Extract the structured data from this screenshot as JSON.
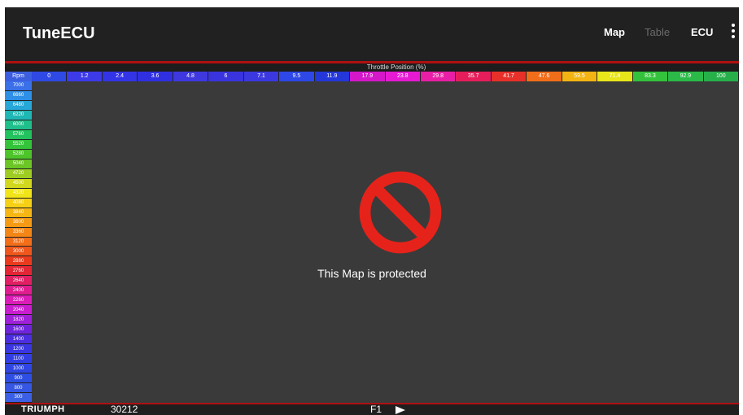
{
  "app": {
    "title": "TuneECU"
  },
  "nav": {
    "map_label": "Map",
    "table_label": "Table",
    "ecu_label": "ECU",
    "menu_icon": "more-vert-icon"
  },
  "grid": {
    "x_axis_title": "Throttle Position (%)",
    "rpm_header": "Rpm",
    "tps_columns": [
      {
        "label": "0",
        "color": "#2f49e4"
      },
      {
        "label": "1.2",
        "color": "#3d3ae8"
      },
      {
        "label": "2.4",
        "color": "#3234e6"
      },
      {
        "label": "3.6",
        "color": "#3030e2"
      },
      {
        "label": "4.8",
        "color": "#3f38df"
      },
      {
        "label": "6",
        "color": "#3a34df"
      },
      {
        "label": "7.1",
        "color": "#3b38e0"
      },
      {
        "label": "9.5",
        "color": "#2d48e6"
      },
      {
        "label": "11.9",
        "color": "#2437d8"
      },
      {
        "label": "17.9",
        "color": "#d417c9"
      },
      {
        "label": "23.8",
        "color": "#e51ad2"
      },
      {
        "label": "29.8",
        "color": "#e81fa6"
      },
      {
        "label": "35.7",
        "color": "#e51d5b"
      },
      {
        "label": "41.7",
        "color": "#e8302a"
      },
      {
        "label": "47.6",
        "color": "#f06d1a"
      },
      {
        "label": "59.5",
        "color": "#f3b413"
      },
      {
        "label": "71.4",
        "color": "#e8e61b"
      },
      {
        "label": "83.3",
        "color": "#34c23c"
      },
      {
        "label": "92.9",
        "color": "#2bba48"
      },
      {
        "label": "100",
        "color": "#27b04a"
      }
    ],
    "rpm_rows": [
      {
        "label": "7000",
        "color": "#3a70e8"
      },
      {
        "label": "6660",
        "color": "#2e8fe6"
      },
      {
        "label": "6480",
        "color": "#26a7d8"
      },
      {
        "label": "6220",
        "color": "#1fb7b4"
      },
      {
        "label": "6000",
        "color": "#1fbf8b"
      },
      {
        "label": "5760",
        "color": "#22c25e"
      },
      {
        "label": "5520",
        "color": "#34c43a"
      },
      {
        "label": "5280",
        "color": "#4cc42a"
      },
      {
        "label": "5040",
        "color": "#6bc626"
      },
      {
        "label": "4720",
        "color": "#9ecc22"
      },
      {
        "label": "4500",
        "color": "#d1d81d"
      },
      {
        "label": "4320",
        "color": "#f1e419"
      },
      {
        "label": "4080",
        "color": "#f6d015"
      },
      {
        "label": "3840",
        "color": "#f6b614"
      },
      {
        "label": "3600",
        "color": "#f59a14"
      },
      {
        "label": "3360",
        "color": "#f48616"
      },
      {
        "label": "3120",
        "color": "#f26e18"
      },
      {
        "label": "3000",
        "color": "#ef561c"
      },
      {
        "label": "2880",
        "color": "#ea3a1e"
      },
      {
        "label": "2760",
        "color": "#e42535"
      },
      {
        "label": "2640",
        "color": "#e21f63"
      },
      {
        "label": "2400",
        "color": "#e01d8f"
      },
      {
        "label": "2260",
        "color": "#dc1cb6"
      },
      {
        "label": "2040",
        "color": "#c91dcf"
      },
      {
        "label": "1820",
        "color": "#a01fd8"
      },
      {
        "label": "1600",
        "color": "#6f24dc"
      },
      {
        "label": "1400",
        "color": "#4c2de0"
      },
      {
        "label": "1200",
        "color": "#3a36e2"
      },
      {
        "label": "1100",
        "color": "#323ee4"
      },
      {
        "label": "1000",
        "color": "#2f46e4"
      },
      {
        "label": "900",
        "color": "#2f4fe4"
      },
      {
        "label": "800",
        "color": "#3557e4"
      },
      {
        "label": "300",
        "color": "#3c60e5"
      }
    ]
  },
  "message": {
    "protected": "This Map is protected",
    "icon": "prohibited-icon",
    "icon_color": "#e5231b"
  },
  "status": {
    "brand": "TRIUMPH",
    "ecu_id": "30212",
    "map_id": "F1",
    "play_icon": "play-icon"
  }
}
